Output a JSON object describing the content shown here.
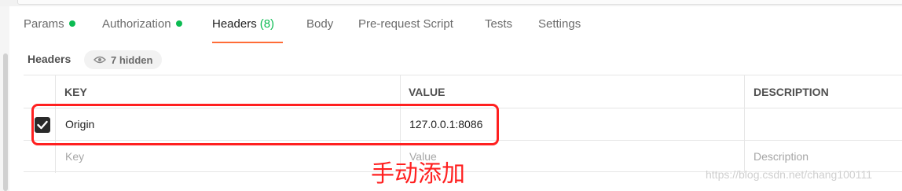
{
  "tabs": [
    {
      "label": "Params",
      "dot": true
    },
    {
      "label": "Authorization",
      "dot": true
    },
    {
      "label": "Headers",
      "count": "(8)",
      "active": true
    },
    {
      "label": "Body"
    },
    {
      "label": "Pre-request Script"
    },
    {
      "label": "Tests"
    },
    {
      "label": "Settings"
    }
  ],
  "headers_section": {
    "title": "Headers",
    "hidden_label": "7 hidden",
    "hidden_icon": "eye-icon"
  },
  "table": {
    "columns": {
      "key": "KEY",
      "value": "VALUE",
      "description": "DESCRIPTION"
    },
    "rows": [
      {
        "checked": true,
        "key": "Origin",
        "value": "127.0.0.1:8086",
        "description": ""
      }
    ],
    "placeholders": {
      "key": "Key",
      "value": "Value",
      "description": "Description"
    }
  },
  "annotation": {
    "text": "手动添加",
    "color": "#ff2020"
  },
  "watermark": "https://blog.csdn.net/chang100111",
  "colors": {
    "accent": "#ff6c37",
    "status_dot": "#0cbb52",
    "highlight": "#ff2020"
  }
}
